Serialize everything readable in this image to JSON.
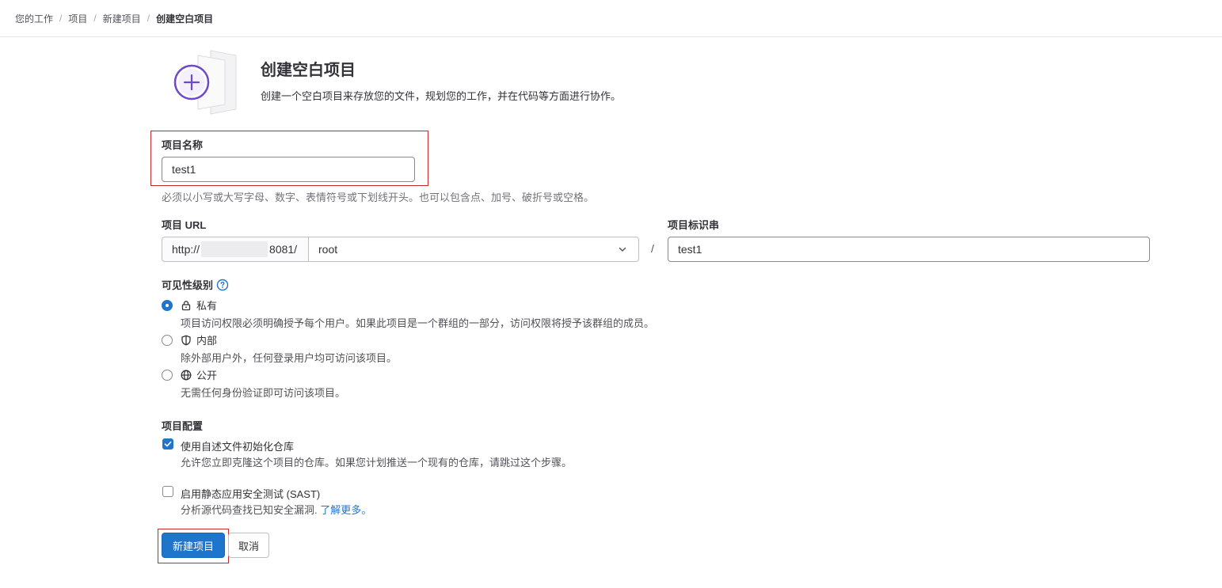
{
  "breadcrumb": {
    "items": [
      "您的工作",
      "项目",
      "新建项目"
    ],
    "current": "创建空白项目",
    "separator": "/"
  },
  "header": {
    "title": "创建空白项目",
    "description": "创建一个空白项目来存放您的文件，规划您的工作，并在代码等方面进行协作。",
    "illustration_icon": "plus-circle-icon"
  },
  "project_name": {
    "label": "项目名称",
    "value": "test1",
    "help": "必须以小写或大写字母、数字、表情符号或下划线开头。也可以包含点、加号、破折号或空格。"
  },
  "project_url": {
    "label": "项目 URL",
    "prefix_start": "http://",
    "prefix_end": "8081/",
    "namespace": "root",
    "separator": "/"
  },
  "project_slug": {
    "label": "项目标识串",
    "value": "test1"
  },
  "visibility": {
    "label": "可见性级别",
    "help_icon": "question-circle-icon",
    "options": [
      {
        "label": "私有",
        "icon": "lock-icon",
        "description": "项目访问权限必须明确授予每个用户。如果此项目是一个群组的一部分，访问权限将授予该群组的成员。",
        "checked": true
      },
      {
        "label": "内部",
        "icon": "shield-icon",
        "description": "除外部用户外，任何登录用户均可访问该项目。",
        "checked": false
      },
      {
        "label": "公开",
        "icon": "globe-icon",
        "description": "无需任何身份验证即可访问该项目。",
        "checked": false
      }
    ]
  },
  "config": {
    "label": "项目配置",
    "readme": {
      "label": "使用自述文件初始化仓库",
      "description": "允许您立即克隆这个项目的仓库。如果您计划推送一个现有的仓库，请跳过这个步骤。",
      "checked": true
    },
    "sast": {
      "label": "启用静态应用安全测试 (SAST)",
      "description": "分析源代码查找已知安全漏洞.",
      "link": "了解更多。",
      "checked": false
    }
  },
  "actions": {
    "create": "新建项目",
    "cancel": "取消"
  },
  "colors": {
    "primary": "#1f75cb",
    "highlight": "#c52b2b",
    "illustration": "#6e49cb"
  }
}
